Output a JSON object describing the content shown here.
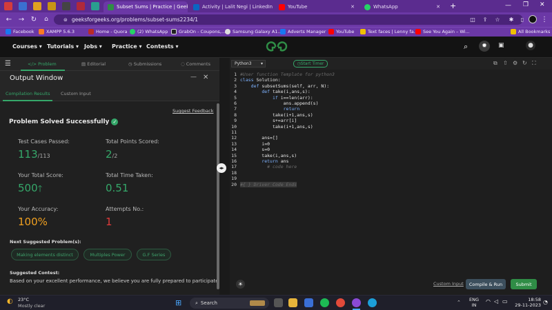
{
  "browser": {
    "tabs": [
      {
        "label": "Subset Sums | Practice | Geeksf",
        "active": true
      },
      {
        "label": "Activity | Lalit Negi | LinkedIn",
        "active": false
      },
      {
        "label": "YouTube",
        "active": false
      },
      {
        "label": "WhatsApp",
        "active": false
      }
    ],
    "url": "geeksforgeeks.org/problems/subset-sums2234/1",
    "bookmarks": [
      "Facebook",
      "XAMPP 5.6.3",
      "Home - Quora",
      "(2) WhatsApp",
      "GrabOn - Coupons,...",
      "Samsung Galaxy A1...",
      "Adverts Manager",
      "YouTube",
      "Text faces | Lenny fa...",
      "See You Again – Wi..."
    ],
    "all_bookmarks": "All Bookmarks"
  },
  "gfg": {
    "nav": [
      "Courses",
      "Tutorials",
      "Jobs",
      "Practice",
      "Contests"
    ],
    "logo": "GfG"
  },
  "left": {
    "tabs": [
      "Problem",
      "Editorial",
      "Submissions",
      "Comments"
    ],
    "output_title": "Output Window",
    "subtabs": [
      "Compilation Results",
      "Custom Input"
    ],
    "suggest_feedback": "Suggest Feedback",
    "status": "Problem Solved Successfully",
    "stats": {
      "test_cases_label": "Test Cases Passed:",
      "test_cases_value": "113",
      "test_cases_total": "/113",
      "points_label": "Total Points Scored:",
      "points_value": "2",
      "points_total": "/2",
      "score_label": "Your Total Score:",
      "score_value": "500",
      "time_label": "Total Time Taken:",
      "time_value": "0.51",
      "accuracy_label": "Your Accuracy:",
      "accuracy_value": "100%",
      "attempts_label": "Attempts No.:",
      "attempts_value": "1"
    },
    "next_label": "Next Suggested Problem(s):",
    "next_problems": [
      "Making elements distinct",
      "Multiples Power",
      "G.F Series"
    ],
    "contest_label": "Suggested Contest:",
    "contest_text": "Based on your excellent performance, we believe you are fully prepared to participate in"
  },
  "editor": {
    "language": "Python3",
    "timer": "Start Timer",
    "lines": [
      "#User function Template for python3",
      "class Solution:",
      "    def subsetSums(self, arr, N):",
      "        def take(i,ans,s):",
      "            if i==len(arr):",
      "                ans.append(s)",
      "                return",
      "            take(i+1,ans,s)",
      "            s+=arr[i]",
      "            take(i+1,ans,s)",
      "",
      "        ans=[]",
      "        i=0",
      "        s=0",
      "        take(i,ans,s)",
      "        return ans",
      "          # code here",
      "",
      "",
      "#{ } Driver Code Ends"
    ],
    "custom_input": "Custom Input",
    "compile": "Compile & Run",
    "submit": "Submit"
  },
  "taskbar": {
    "weather_temp": "23°C",
    "weather_desc": "Mostly clear",
    "search": "Search",
    "lang": "ENG",
    "region": "IN",
    "time": "18:58",
    "date": "29-11-2023"
  },
  "colors": {
    "accent": "#35a86a",
    "orange": "#f0a020",
    "red": "#e03a3a",
    "browser": "#6b38a6"
  }
}
